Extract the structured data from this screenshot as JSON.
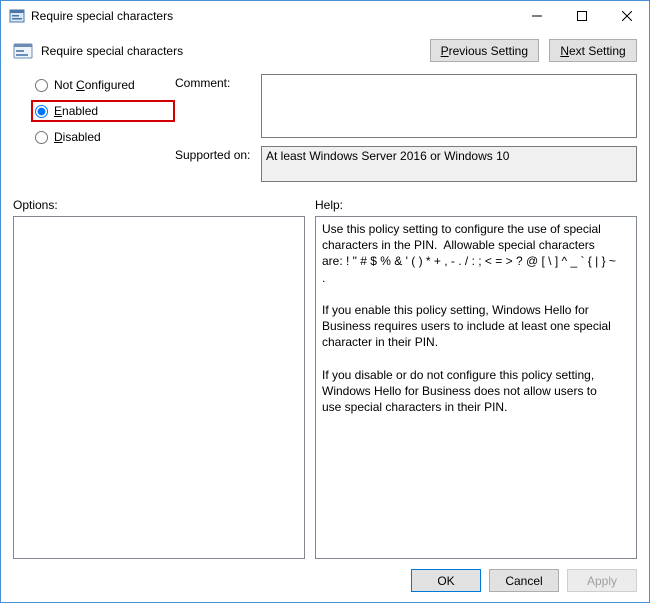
{
  "window": {
    "title": "Require special characters"
  },
  "header": {
    "policy_title": "Require special characters",
    "prev_label_pre": "P",
    "prev_label_post": "revious Setting",
    "next_label_pre": "N",
    "next_label_post": "ext Setting"
  },
  "state": {
    "not_configured_pre": "Not ",
    "not_configured_mn": "C",
    "not_configured_post": "onfigured",
    "enabled_mn": "E",
    "enabled_post": "nabled",
    "disabled_mn": "D",
    "disabled_post": "isabled",
    "selected": "enabled"
  },
  "fields": {
    "comment_label": "Comment:",
    "comment_value": "",
    "supported_label": "Supported on:",
    "supported_value": "At least Windows Server 2016 or Windows 10"
  },
  "panes": {
    "options_label": "Options:",
    "help_label": "Help:",
    "help_text": "Use this policy setting to configure the use of special characters in the PIN.  Allowable special characters are: ! \" # $ % & ' ( ) * + , - . / : ; < = > ? @ [ \\ ] ^ _ ` { | } ~ .\n\nIf you enable this policy setting, Windows Hello for Business requires users to include at least one special character in their PIN.\n\nIf you disable or do not configure this policy setting, Windows Hello for Business does not allow users to use special characters in their PIN."
  },
  "footer": {
    "ok": "OK",
    "cancel": "Cancel",
    "apply": "Apply"
  }
}
